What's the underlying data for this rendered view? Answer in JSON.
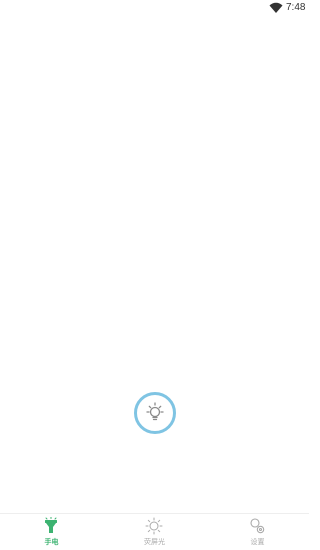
{
  "status_bar": {
    "time": "7:48",
    "wifi_icon": "wifi-icon"
  },
  "main": {
    "light_button_icon": "lightbulb-icon",
    "accent_color": "#7fc4e3"
  },
  "bottom_nav": {
    "active_color": "#3cb371",
    "inactive_color": "#aaaaaa",
    "items": [
      {
        "label": "手电",
        "icon": "flashlight-icon",
        "active": true
      },
      {
        "label": "荧屏光",
        "icon": "sun-icon",
        "active": false
      },
      {
        "label": "设置",
        "icon": "settings-icon",
        "active": false
      }
    ]
  }
}
